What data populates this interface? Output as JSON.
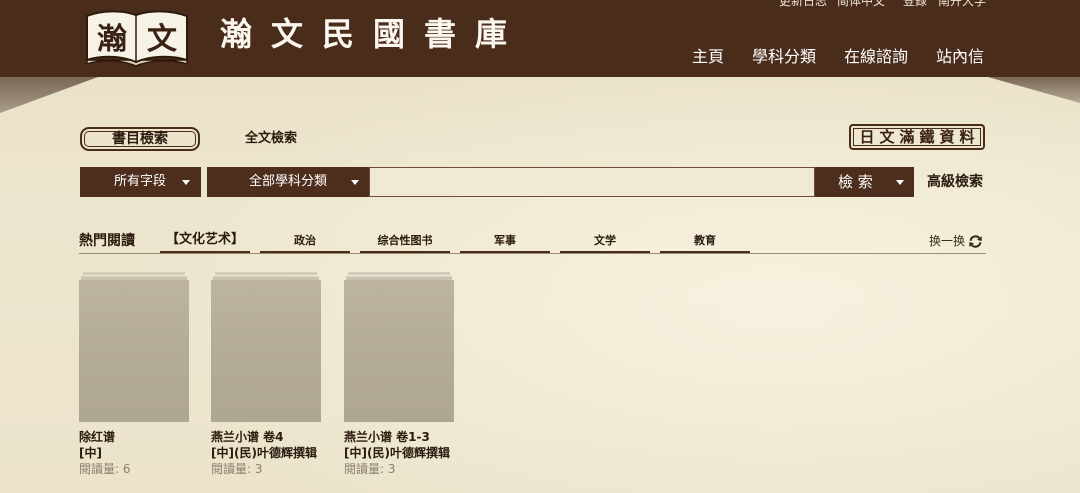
{
  "header": {
    "logo": {
      "left_char": "瀚",
      "right_char": "文"
    },
    "site_title": "瀚文民國書庫",
    "top_links": [
      "更新日志",
      "简体中文",
      "登錄",
      "南开大学"
    ],
    "nav": [
      "主頁",
      "學科分類",
      "在線諮詢",
      "站內信"
    ]
  },
  "search": {
    "tabs": {
      "catalog": "書目檢索",
      "fulltext": "全文檢索"
    },
    "special_link": "日文滿鐵資料",
    "field_select": "所有字段",
    "category_select": "全部學科分類",
    "query_value": "",
    "search_button": "檢 索",
    "advanced": "高級檢索"
  },
  "hot": {
    "title": "熱門閱讀",
    "tabs": [
      "【文化艺术】",
      "政治",
      "综合性图书",
      "军事",
      "文学",
      "教育"
    ],
    "refresh": "换一换",
    "books": [
      {
        "title": "除红谱",
        "lang": "[中]",
        "reads": "閱讀量: 6"
      },
      {
        "title": "燕兰小谱 卷4",
        "lang": "[中](民)叶德辉撰辑",
        "reads": "閱讀量: 3"
      },
      {
        "title": "燕兰小谱 卷1-3",
        "lang": "[中](民)叶德辉撰辑",
        "reads": "閱讀量: 3"
      }
    ]
  },
  "icons": {
    "logo": "open-book-logo",
    "dropdown": "caret-down-icon",
    "refresh": "refresh-icon"
  },
  "colors": {
    "header_bg": "#4a2c1b",
    "parchment": "#ece5cc",
    "button_bg": "#4d2e1c",
    "cover": "#b4ab99"
  }
}
